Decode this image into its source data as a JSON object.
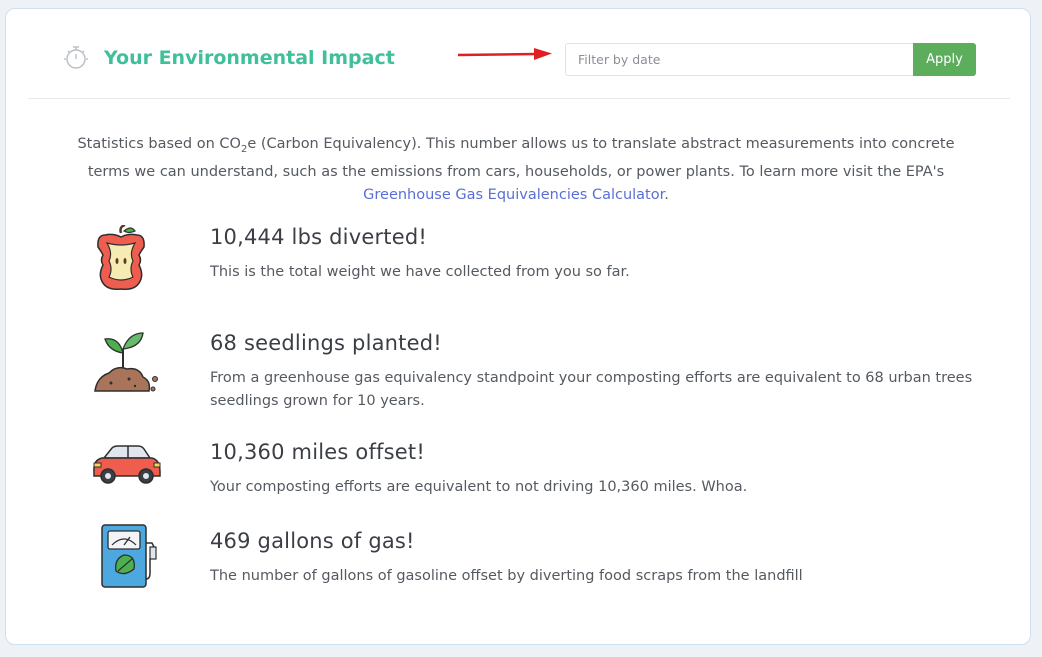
{
  "header": {
    "title": "Your Environmental Impact",
    "filter_placeholder": "Filter by date",
    "apply_label": "Apply"
  },
  "intro": {
    "text_before_sub": "Statistics based on CO",
    "sub": "2",
    "text_after_sub": "e (Carbon Equivalency). This number allows us to translate abstract measurements into concrete terms we can understand, such as the emissions from cars, households, or power plants. To learn more visit the EPA's ",
    "link": "Greenhouse Gas Equivalencies Calculator",
    "text_end": "."
  },
  "stats": [
    {
      "icon": "apple-core-icon",
      "title": "10,444 lbs diverted!",
      "desc": "This is the total weight we have collected from you so far."
    },
    {
      "icon": "seedling-icon",
      "title": "68 seedlings planted!",
      "desc": "From a greenhouse gas equivalency standpoint your composting efforts are equivalent to 68 urban trees seedlings grown for 10 years."
    },
    {
      "icon": "car-icon",
      "title": "10,360 miles offset!",
      "desc": "Your composting efforts are equivalent to not driving 10,360 miles. Whoa."
    },
    {
      "icon": "gas-pump-icon",
      "title": "469 gallons of gas!",
      "desc": "The number of gallons of gasoline offset by diverting food scraps from the landfill"
    }
  ],
  "colors": {
    "accent": "#3fbf9a",
    "button": "#5cae5c",
    "link": "#5a6fd6",
    "arrow": "#e02020"
  }
}
